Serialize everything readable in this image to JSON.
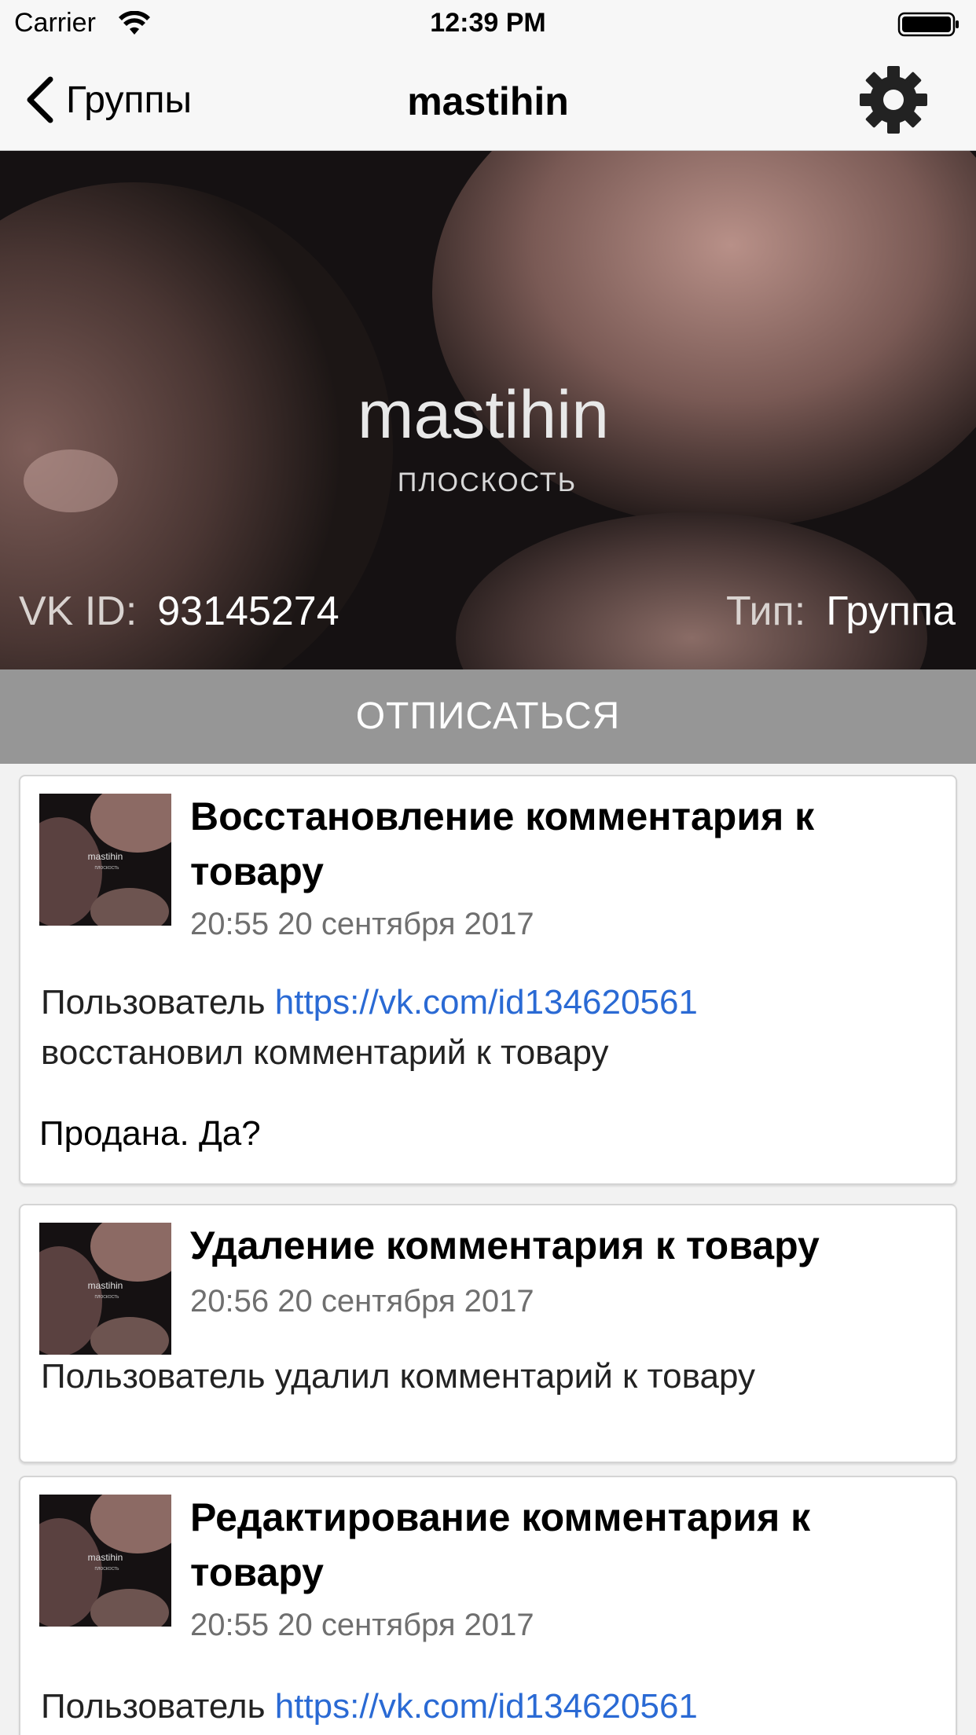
{
  "status_bar": {
    "carrier": "Carrier",
    "time": "12:39 PM"
  },
  "nav": {
    "back_label": "Группы",
    "title": "mastihin"
  },
  "group": {
    "cover_title": "mastihin",
    "cover_subtitle": "ПЛОСКОСТЬ",
    "vk_id_label": "VK ID:",
    "vk_id": "93145274",
    "type_label": "Тип:",
    "type_value": "Группа",
    "unsubscribe_label": "ОТПИСАТЬСЯ"
  },
  "events": [
    {
      "title": "Восстановление комментария к товару",
      "date": "20:55 20 сентября 2017",
      "text_prefix": "Пользователь ",
      "link": "https://vk.com/id134620561",
      "text_suffix": "восстановил комментарий к товару",
      "quote": "Продана. Да?"
    },
    {
      "title": "Удаление комментария к товару",
      "date": "20:56 20 сентября 2017",
      "text": "Пользователь удалил комментарий к товару"
    },
    {
      "title": "Редактирование комментария к товару",
      "date": "20:55 20 сентября 2017",
      "text_prefix": "Пользователь ",
      "link": "https://vk.com/id134620561"
    }
  ],
  "thumbnail_caption": "mastihin",
  "thumbnail_subcaption": "ПЛОСКОСТЬ",
  "colors": {
    "link": "#2a6ad4",
    "unsubscribe_bg": "#969696",
    "bar_bg": "#f7f7f7"
  }
}
